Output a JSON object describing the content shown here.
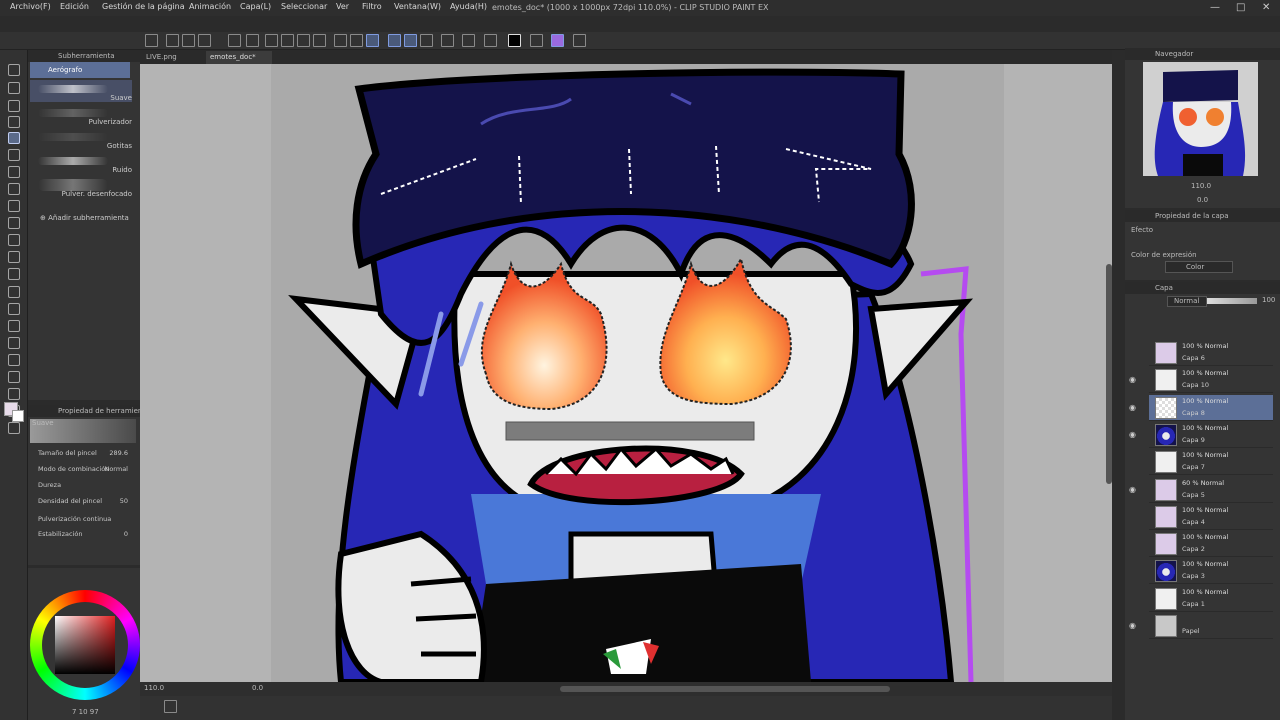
{
  "window": {
    "title": "emotes_doc* (1000 x 1000px 72dpi 110.0%) - CLIP STUDIO PAINT EX"
  },
  "menu": [
    "Archivo(F)",
    "Edición",
    "Gestión de la página",
    "Animación",
    "Capa(L)",
    "Seleccionar",
    "Ver",
    "Filtro",
    "Ventana(W)",
    "Ayuda(H)"
  ],
  "subtool_panel": {
    "header": "Subherramienta",
    "group": "Aerógrafo",
    "brushes": [
      "Suave",
      "Pulverizador",
      "Gotitas",
      "Ruido",
      "Pulver. desenfocado"
    ],
    "selected_index": 0,
    "add_label": "Añadir subherramienta"
  },
  "tool_property": {
    "header": "Propiedad de herramienta",
    "preset": "Suave",
    "rows": [
      {
        "label": "Tamaño del pincel",
        "value": "289.6"
      },
      {
        "label": "Modo de combinación",
        "value": "Normal"
      },
      {
        "label": "Dureza",
        "value": ""
      },
      {
        "label": "Densidad del pincel",
        "value": "50"
      },
      {
        "label": "Pulverización continua",
        "value": ""
      },
      {
        "label": "Estabilización",
        "value": "0"
      }
    ]
  },
  "doc_tabs": [
    {
      "label": "LIVE.png",
      "active": false
    },
    {
      "label": "emotes_doc*",
      "active": true
    }
  ],
  "status": {
    "zoom": "110.0",
    "angle": "0.0",
    "color_values": "7  10  97"
  },
  "navigator": {
    "header": "Navegador",
    "zoom": "110.0",
    "angle": "0.0"
  },
  "layer_property": {
    "header": "Propiedad de la capa",
    "effect_label": "Efecto",
    "expression_label": "Color de expresión",
    "expression_value": "Color"
  },
  "layer_panel": {
    "header": "Capa",
    "blend_mode": "Normal",
    "opacity": "100",
    "layers": [
      {
        "mode": "100 % Normal",
        "name": "Capa 6",
        "thumb": "lilac"
      },
      {
        "mode": "100 % Normal",
        "name": "Capa 10",
        "thumb": "sketch"
      },
      {
        "mode": "100 % Normal",
        "name": "Capa 8",
        "thumb": "checker"
      },
      {
        "mode": "100 % Normal",
        "name": "Capa 9",
        "thumb": "character"
      },
      {
        "mode": "100 % Normal",
        "name": "Capa 7",
        "thumb": "sketch"
      },
      {
        "mode": "60 % Normal",
        "name": "Capa 5",
        "thumb": "lilac"
      },
      {
        "mode": "100 % Normal",
        "name": "Capa 4",
        "thumb": "lilac"
      },
      {
        "mode": "100 % Normal",
        "name": "Capa 2",
        "thumb": "lilac"
      },
      {
        "mode": "100 % Normal",
        "name": "Capa 3",
        "thumb": "character"
      },
      {
        "mode": "100 % Normal",
        "name": "Capa 1",
        "thumb": "sketch"
      },
      {
        "mode": "",
        "name": "Papel",
        "thumb": "paper"
      }
    ],
    "selected_index": 2
  },
  "colors": {
    "accent": "#5c6f97",
    "hair": "#2727b5",
    "beanie": "#14134a",
    "skin": "#ebebeb",
    "fire": "#f06030"
  }
}
